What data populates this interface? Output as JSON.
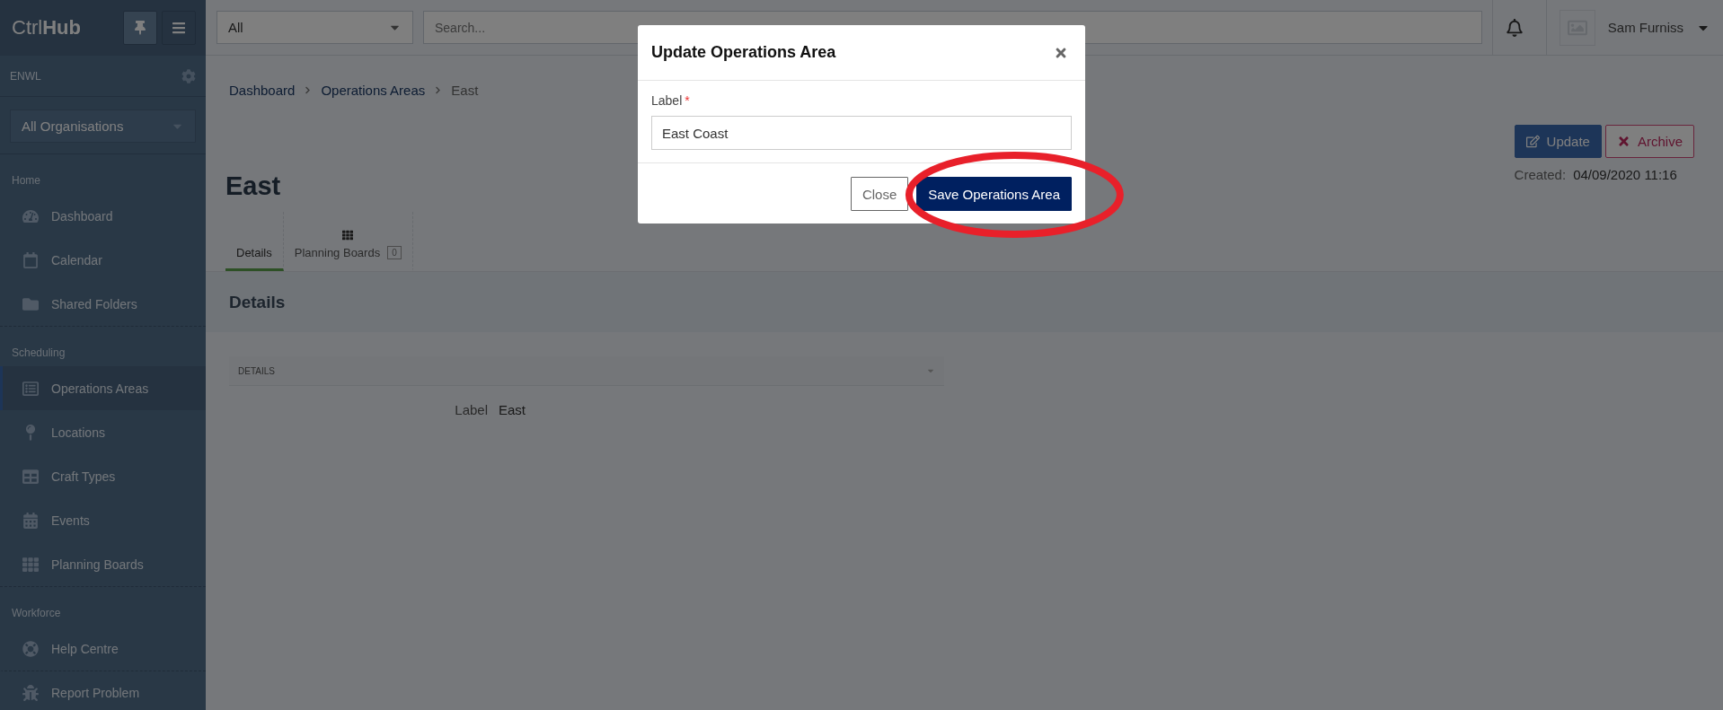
{
  "sidebar": {
    "logo": "Ctrl**Hub**",
    "organisation": "ENWL",
    "org_select": "All Organisations",
    "sections": [
      {
        "title": "Home",
        "items": [
          {
            "label": "Dashboard",
            "selected": false
          },
          {
            "label": "Calendar",
            "selected": false
          },
          {
            "label": "Shared Folders",
            "selected": false
          }
        ]
      },
      {
        "title": "Scheduling",
        "items": [
          {
            "label": "Operations Areas",
            "selected": true
          },
          {
            "label": "Locations",
            "selected": false
          },
          {
            "label": "Craft Types",
            "selected": false
          },
          {
            "label": "Events",
            "selected": false
          },
          {
            "label": "Planning Boards",
            "selected": false
          }
        ]
      },
      {
        "title": "Workforce"
      }
    ],
    "support_items": [
      {
        "label": "Help Centre"
      },
      {
        "label": "Report Problem"
      }
    ]
  },
  "topbar": {
    "filter_select": "All",
    "search": {
      "placeholder": "Search..."
    },
    "user_name": "Sam Furniss"
  },
  "breadcrumb": [
    "Dashboard",
    "Operations Areas",
    "East"
  ],
  "page": {
    "title": "East",
    "actions": [
      {
        "label": "Update",
        "kind": "primary"
      },
      {
        "label": "Archive",
        "kind": "danger"
      }
    ],
    "created_label": "Created:",
    "created_value": "04/09/2020 11:16"
  },
  "tabs": [
    {
      "label": "Details",
      "selected": true
    },
    {
      "label": "Planning Boards",
      "badge": "0",
      "selected": false
    }
  ],
  "section_heading": "Details",
  "panel": {
    "header": "DETAILS",
    "fields": [
      {
        "label": "Label",
        "value": "East"
      }
    ]
  },
  "modal": {
    "title": "Update Operations Area",
    "field_label": "Label",
    "required_mark": "*",
    "value": "East Coast",
    "buttons": [
      {
        "label": "Close",
        "kind": "secondary",
        "highlighted": false
      },
      {
        "label": "Save Operations Area",
        "kind": "primary",
        "highlighted": true
      }
    ]
  }
}
